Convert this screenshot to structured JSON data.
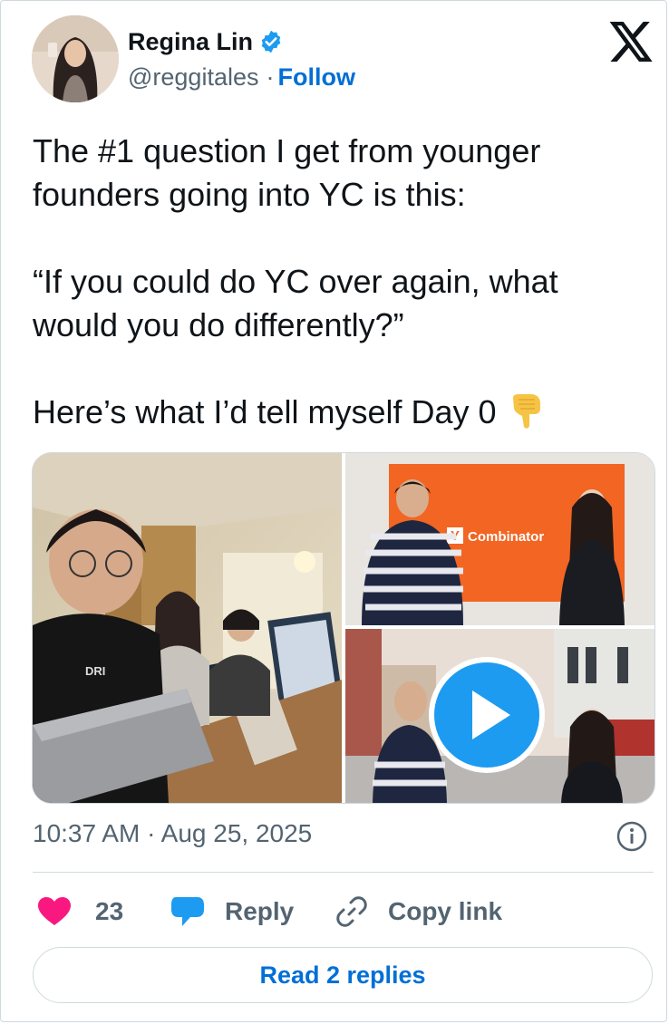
{
  "author": {
    "name": "Regina Lin",
    "handle": "@reggitales",
    "separator": "·",
    "follow_label": "Follow",
    "verified": true
  },
  "tweet": {
    "text": "The #1 question I get from younger founders going into YC is this:\n\n“If you could do YC over again, what would you do differently?”\n\nHere’s what I’d tell myself Day 0",
    "emoji": "backhand-index-pointing-down"
  },
  "media": {
    "photo_top_right_sign": "Combinator",
    "photo_top_right_logo_letter": "Y",
    "shirt_text": "DRI"
  },
  "meta": {
    "timestamp": "10:37 AM · Aug 25, 2025"
  },
  "actions": {
    "like_count": "23",
    "reply_label": "Reply",
    "copy_link_label": "Copy link"
  },
  "footer": {
    "read_replies_label": "Read 2 replies"
  },
  "colors": {
    "accent_blue": "#006fd6",
    "like_pink": "#f91880",
    "reply_blue": "#1d9bf0",
    "muted_text": "#536471",
    "border": "#cfd9de"
  }
}
